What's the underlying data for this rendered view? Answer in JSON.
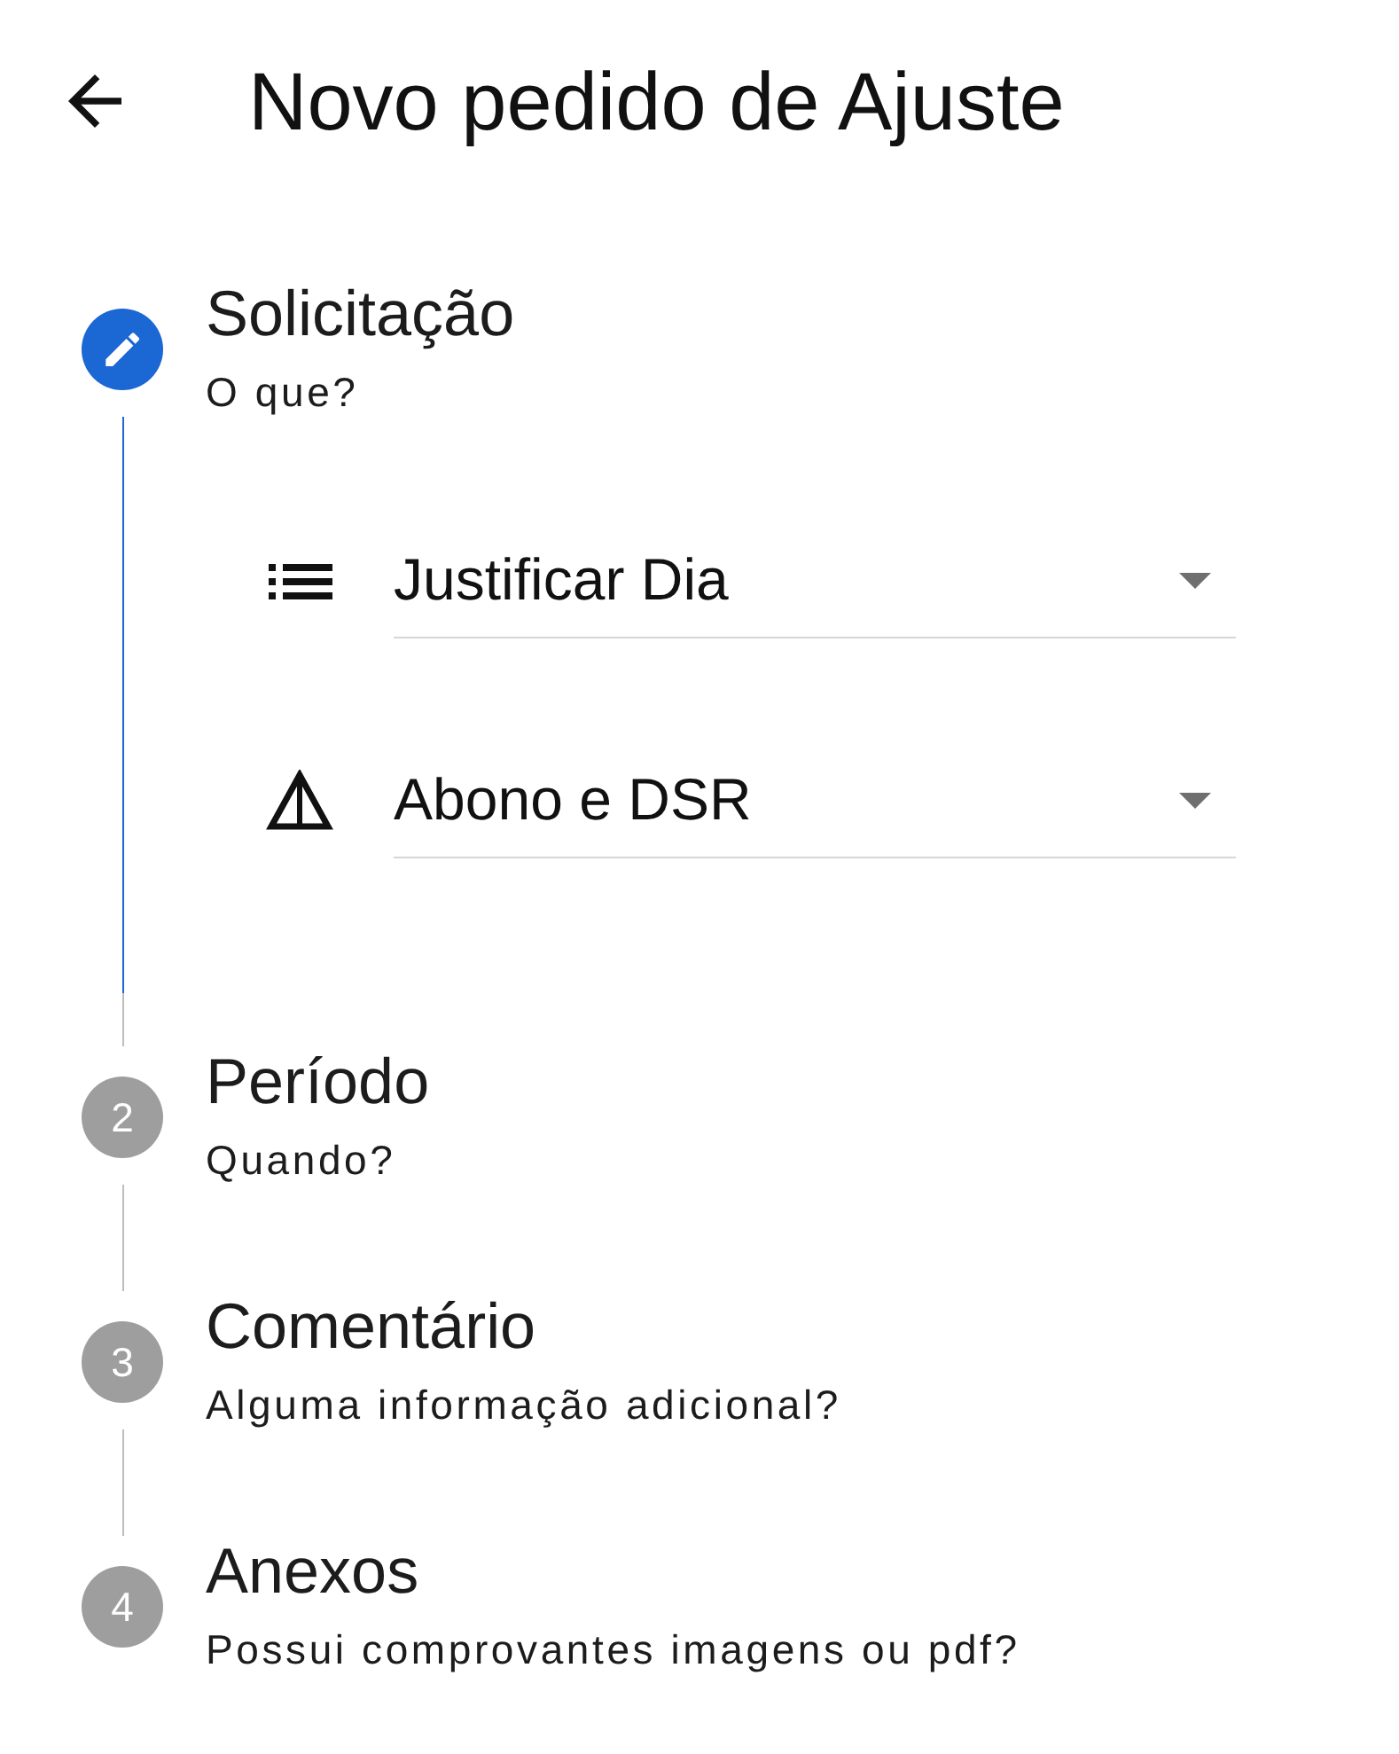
{
  "header": {
    "title": "Novo pedido de Ajuste"
  },
  "steps": [
    {
      "title": "Solicitação",
      "subtitle": "O que?",
      "selected": true,
      "fields": [
        {
          "value": "Justificar Dia"
        },
        {
          "value": "Abono e DSR"
        }
      ]
    },
    {
      "title": "Período",
      "subtitle": "Quando?",
      "selected": false,
      "number": "2"
    },
    {
      "title": "Comentário",
      "subtitle": "Alguma informação adicional?",
      "selected": false,
      "number": "3"
    },
    {
      "title": "Anexos",
      "subtitle": "Possui comprovantes imagens ou pdf?",
      "selected": false,
      "number": "4"
    }
  ]
}
